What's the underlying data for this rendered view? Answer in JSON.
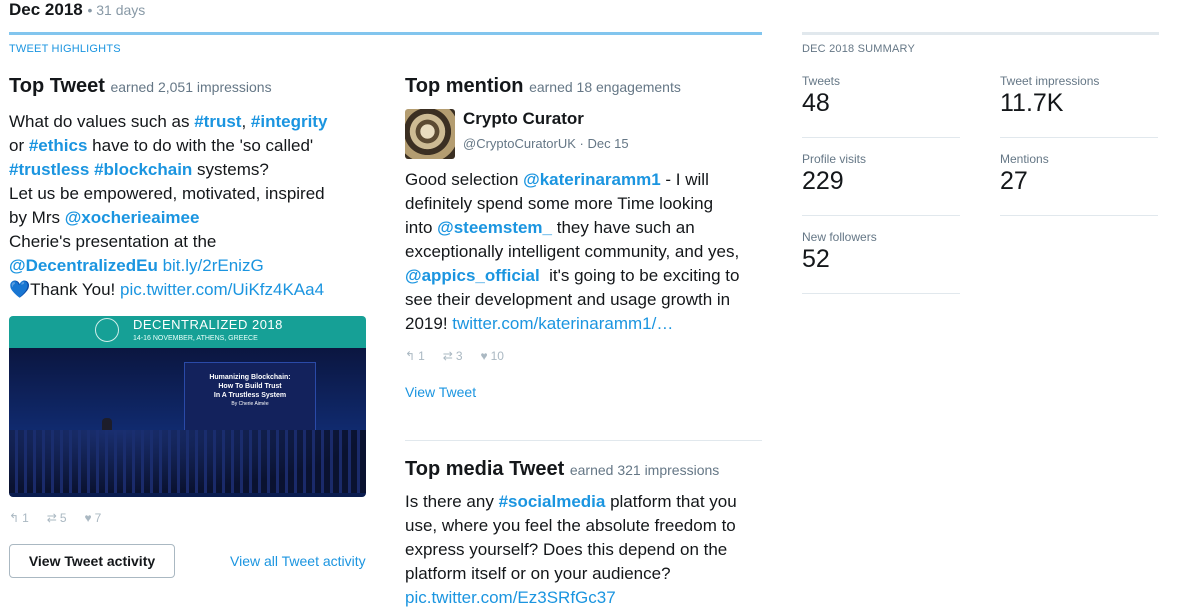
{
  "header": {
    "month": "Dec 2018",
    "days": "31 days"
  },
  "highlights_label": "TWEET HIGHLIGHTS",
  "top_tweet": {
    "title": "Top Tweet",
    "earned": "earned 2,051 impressions",
    "text_parts": {
      "p1": "What do values such as ",
      "trust": "#trust",
      "comma": ", ",
      "integrity": "#integrity",
      "p2": "or ",
      "ethics": "#ethics",
      "p3": " have to do with the 'so called'",
      "trustless": "#trustless",
      "sp": " ",
      "blockchain": "#blockchain",
      "p4": " systems?",
      "p5": "Let us be empowered, motivated, inspired",
      "p6": "by Mrs ",
      "xocherie": "@xocherieaimee",
      "p7": "Cherie's presentation at the",
      "decentralized": "@DecentralizedEu",
      "bitly": "bit.ly/2rEnizG",
      "heart": "💙",
      "p8": "Thank You! ",
      "pic": "pic.twitter.com/UiKfz4KAa4"
    },
    "image": {
      "banner_title": "DECENTRALIZED 2018",
      "banner_sub": "14-16 NOVEMBER, ATHENS, GREECE",
      "screen_l1": "Humanizing Blockchain:",
      "screen_l2": "How To Build Trust",
      "screen_l3": "In A Trustless System",
      "screen_l4": "By Cherie Aimée"
    },
    "replies": "1",
    "retweets": "5",
    "likes": "7",
    "view_activity_btn": "View Tweet activity",
    "view_all_link": "View all Tweet activity"
  },
  "top_mention": {
    "title": "Top mention",
    "earned": "earned 18 engagements",
    "name": "Crypto Curator",
    "handle": "@CryptoCuratorUK · Dec 15",
    "text_parts": {
      "p1": "Good selection ",
      "katerina": "@katerinaramm1",
      "p2": " - I will",
      "p3": "definitely spend some more Time looking",
      "p4": "into ",
      "steemstem": "@steemstem_",
      "p5": " they have such an",
      "p6": "exceptionally intelligent community, and yes,",
      "appics": "@appics_official",
      "p7": "  it's going to be exciting to",
      "p8": "see their development and usage growth in",
      "p9": "2019! ",
      "link": "twitter.com/katerinaramm1/…"
    },
    "replies": "1",
    "retweets": "3",
    "likes": "10",
    "view_tweet": "View Tweet"
  },
  "top_media": {
    "title": "Top media Tweet",
    "earned": "earned 321 impressions",
    "text_parts": {
      "p1": "Is there any ",
      "social": "#socialmedia",
      "p2": " platform that you",
      "p3": "use, where you feel the absolute freedom to",
      "p4": "express yourself? Does this depend on the",
      "p5": "platform itself or on your audience?",
      "pic": "pic.twitter.com/Ez3SRfGc37"
    }
  },
  "summary": {
    "label": "DEC 2018 SUMMARY",
    "tweets_label": "Tweets",
    "tweets": "48",
    "impressions_label": "Tweet impressions",
    "impressions": "11.7K",
    "visits_label": "Profile visits",
    "visits": "229",
    "mentions_label": "Mentions",
    "mentions": "27",
    "followers_label": "New followers",
    "followers": "52"
  },
  "icons": {
    "reply": "reply-icon",
    "retweet": "retweet-icon",
    "like": "heart-icon"
  },
  "colors": {
    "accent": "#1b95e0",
    "muted": "#657786"
  }
}
